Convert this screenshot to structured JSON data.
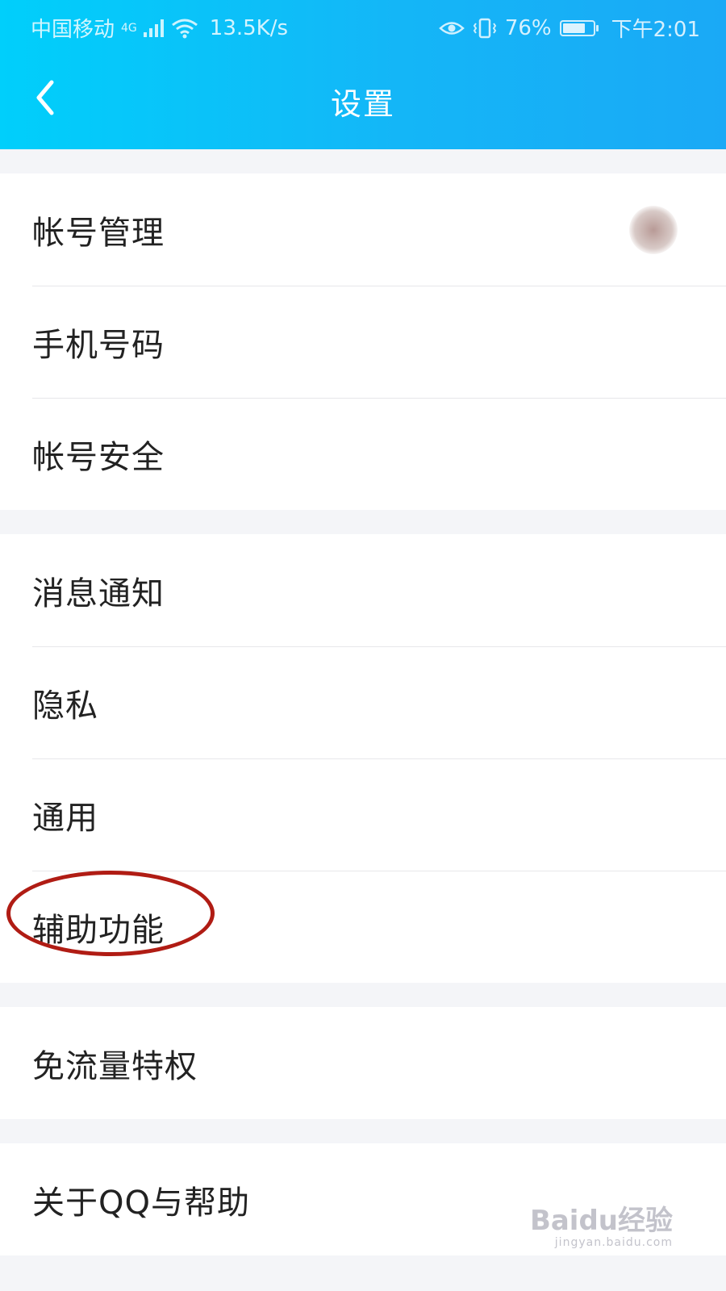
{
  "status_bar": {
    "carrier": "中国移动",
    "network": "4G",
    "speed": "13.5K/s",
    "battery": "76%",
    "battery_level": 0.76,
    "time": "下午2:01"
  },
  "header": {
    "title": "设置",
    "back_icon": "chevron-left-icon"
  },
  "settings": {
    "groups": [
      {
        "items": [
          {
            "label": "帐号管理"
          },
          {
            "label": "手机号码"
          },
          {
            "label": "帐号安全"
          }
        ]
      },
      {
        "items": [
          {
            "label": "消息通知"
          },
          {
            "label": "隐私"
          },
          {
            "label": "通用"
          },
          {
            "label": "辅助功能"
          }
        ]
      },
      {
        "items": [
          {
            "label": "免流量特权"
          }
        ]
      },
      {
        "items": [
          {
            "label": "关于QQ与帮助"
          }
        ]
      }
    ]
  },
  "annotation": {
    "highlighted_item": "辅助功能",
    "color": "#b01c14"
  },
  "watermark": {
    "brand": "Baidu经验",
    "url": "jingyan.baidu.com"
  }
}
